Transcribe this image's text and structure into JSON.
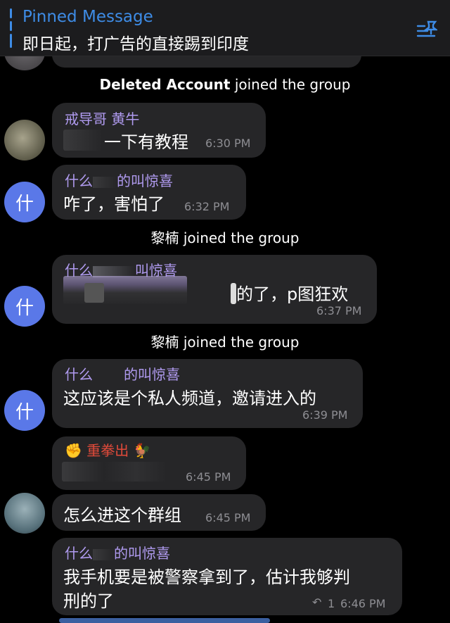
{
  "pinned": {
    "title": "Pinned Message",
    "text": "即日起，打广告的直接踢到印度"
  },
  "services": [
    {
      "name": "Deleted Account",
      "action": "joined the group"
    },
    {
      "name": "黎楠",
      "action": "joined the group"
    },
    {
      "name": "黎楠",
      "action": "joined the group"
    }
  ],
  "messages": [
    {
      "sender": "戒导哥 黄牛",
      "text": "一下有教程",
      "time": "6:30 PM",
      "avatar": ""
    },
    {
      "sender": "什么",
      "sender_suffix": "的叫惊喜",
      "text": "咋了，害怕了",
      "time": "6:32 PM",
      "avatar": "什"
    },
    {
      "sender": "什么",
      "sender_suffix": "叫惊喜",
      "text": "的了，p图狂欢",
      "time": "6:37 PM",
      "avatar": "什"
    },
    {
      "sender": "什么",
      "sender_suffix": "的叫惊喜",
      "text": "这应该是个私人频道，邀请进入的",
      "time": "6:39 PM",
      "avatar": "什"
    },
    {
      "sender": "重拳出",
      "text": "",
      "time": "6:45 PM",
      "avatar": ""
    },
    {
      "sender": "",
      "text": "怎么进这个群组",
      "time": "6:45 PM",
      "avatar": ""
    },
    {
      "sender": "什么",
      "sender_suffix": "的叫惊喜",
      "text_line1": "我手机要是被警察拿到了，估计我够判",
      "text_line2": "刑的了",
      "time": "6:46 PM",
      "reply_count": "1",
      "avatar": ""
    }
  ],
  "icons": {
    "pinned_list": "pinned-list-icon",
    "reply": "reply-arrow-icon",
    "fist": "fist-emoji",
    "chicken": "rooster-emoji"
  },
  "colors": {
    "accent": "#3e8ce6",
    "sender_name": "#b09bf0",
    "bubble": "#262628",
    "avatar_blue": "#5a78e8"
  }
}
